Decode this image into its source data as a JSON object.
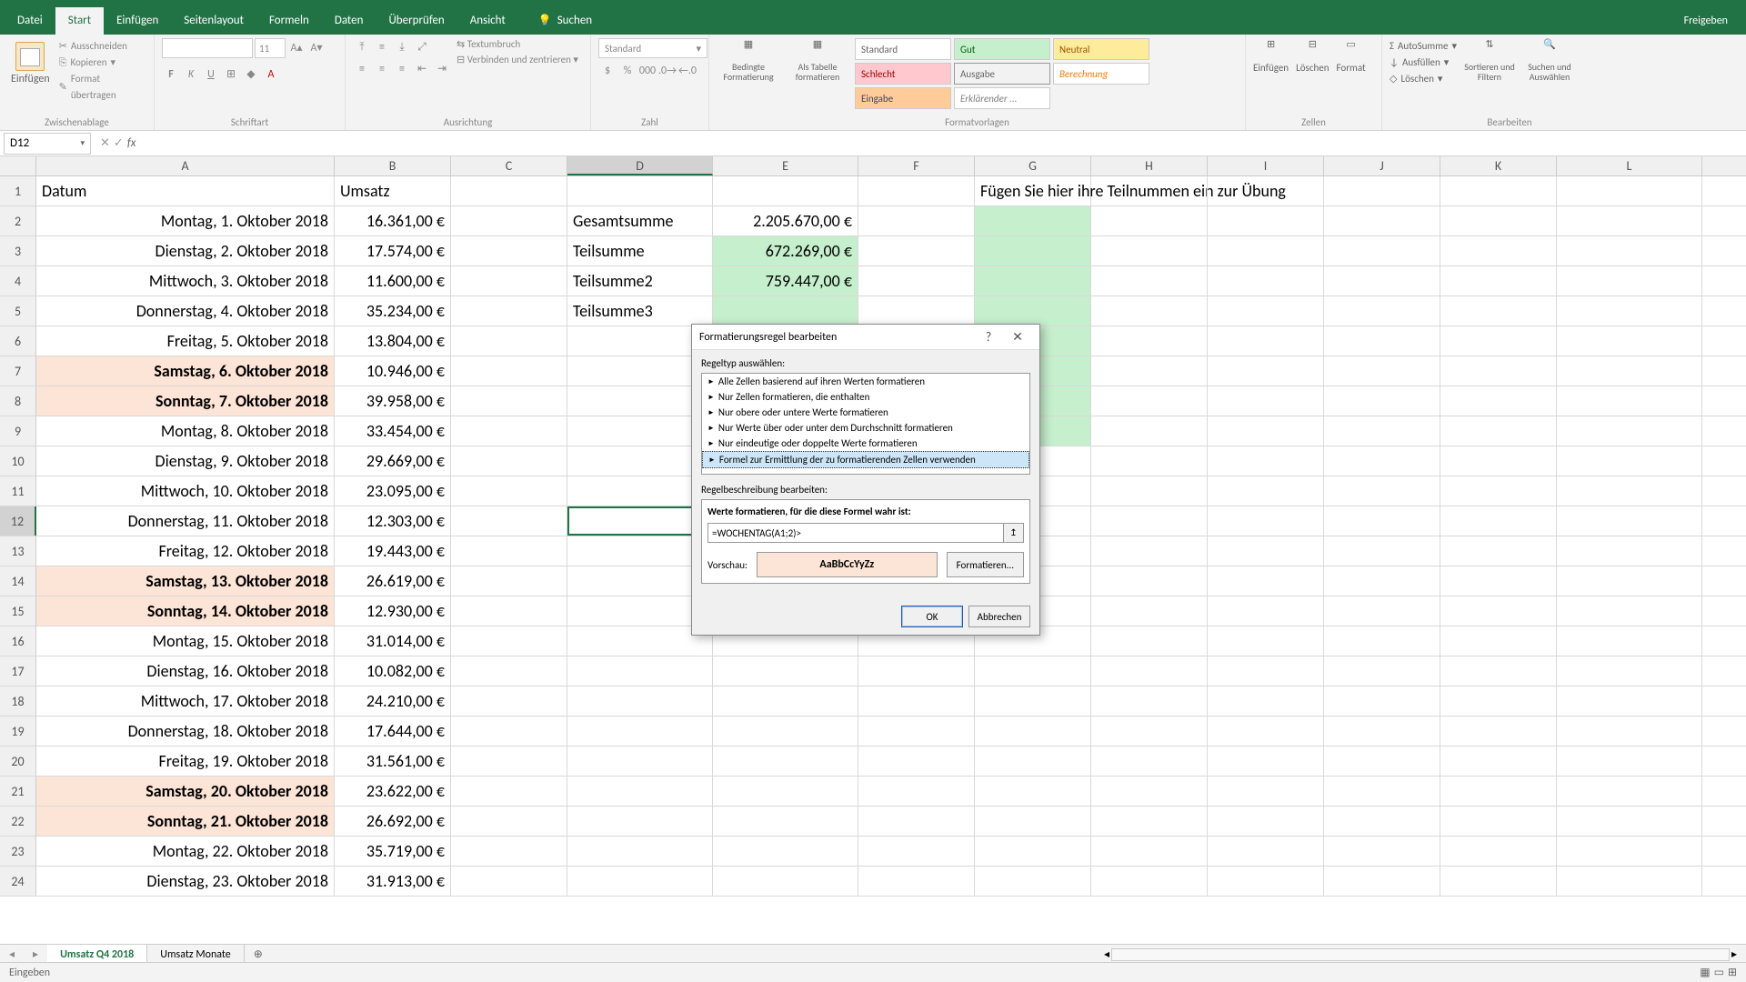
{
  "tabs": {
    "file": "Datei",
    "start": "Start",
    "insert": "Einfügen",
    "page": "Seitenlayout",
    "formulas": "Formeln",
    "data": "Daten",
    "review": "Überprüfen",
    "view": "Ansicht",
    "tell": "Suchen",
    "share": "Freigeben"
  },
  "ribbon": {
    "paste": "Einfügen",
    "cut": "Ausschneiden",
    "copy": "Kopieren",
    "format_painter": "Format übertragen",
    "clipboard": "Zwischenablage",
    "font_name": "",
    "font_size": "11",
    "font_group": "Schriftart",
    "wrap": "Textumbruch",
    "merge": "Verbinden und zentrieren",
    "alignment": "Ausrichtung",
    "num_format": "Standard",
    "number": "Zahl",
    "cond_fmt": "Bedingte Formatierung",
    "as_table": "Als Tabelle formatieren",
    "styles_group": "Formatvorlagen",
    "style_standard": "Standard",
    "style_good": "Gut",
    "style_neutral": "Neutral",
    "style_bad": "Schlecht",
    "style_output": "Ausgabe",
    "style_calc": "Berechnung",
    "style_input": "Eingabe",
    "style_explain": "Erklärender ...",
    "insert_cells": "Einfügen",
    "delete_cells": "Löschen",
    "format_cells": "Format",
    "cells_group": "Zellen",
    "autosum": "AutoSumme",
    "fill": "Ausfüllen",
    "clear": "Löschen",
    "sort_filter": "Sortieren und Filtern",
    "find": "Suchen und Auswählen",
    "editing": "Bearbeiten"
  },
  "namebox": "D12",
  "columns": [
    "A",
    "B",
    "C",
    "D",
    "E",
    "F",
    "G",
    "H",
    "I",
    "J",
    "K",
    "L"
  ],
  "headers": {
    "a1": "Datum",
    "b1": "Umsatz",
    "g1": "Fügen Sie hier ihre Teilnummen ein zur Übung"
  },
  "sums": {
    "d2": "Gesamtsumme",
    "e2": "2.205.670,00 €",
    "d3": "Teilsumme",
    "e3": "672.269,00 €",
    "d4": "Teilsumme2",
    "e4": "759.447,00 €",
    "d5": "Teilsumme3"
  },
  "data_rows": [
    {
      "r": 2,
      "date": "Montag, 1. Oktober 2018",
      "val": "16.361,00 €",
      "w": false
    },
    {
      "r": 3,
      "date": "Dienstag, 2. Oktober 2018",
      "val": "17.574,00 €",
      "w": false
    },
    {
      "r": 4,
      "date": "Mittwoch, 3. Oktober 2018",
      "val": "11.600,00 €",
      "w": false
    },
    {
      "r": 5,
      "date": "Donnerstag, 4. Oktober 2018",
      "val": "35.234,00 €",
      "w": false
    },
    {
      "r": 6,
      "date": "Freitag, 5. Oktober 2018",
      "val": "13.804,00 €",
      "w": false
    },
    {
      "r": 7,
      "date": "Samstag, 6. Oktober 2018",
      "val": "10.946,00 €",
      "w": true
    },
    {
      "r": 8,
      "date": "Sonntag, 7. Oktober 2018",
      "val": "39.958,00 €",
      "w": true
    },
    {
      "r": 9,
      "date": "Montag, 8. Oktober 2018",
      "val": "33.454,00 €",
      "w": false
    },
    {
      "r": 10,
      "date": "Dienstag, 9. Oktober 2018",
      "val": "29.669,00 €",
      "w": false
    },
    {
      "r": 11,
      "date": "Mittwoch, 10. Oktober 2018",
      "val": "23.095,00 €",
      "w": false
    },
    {
      "r": 12,
      "date": "Donnerstag, 11. Oktober 2018",
      "val": "12.303,00 €",
      "w": false
    },
    {
      "r": 13,
      "date": "Freitag, 12. Oktober 2018",
      "val": "19.443,00 €",
      "w": false
    },
    {
      "r": 14,
      "date": "Samstag, 13. Oktober 2018",
      "val": "26.619,00 €",
      "w": true
    },
    {
      "r": 15,
      "date": "Sonntag, 14. Oktober 2018",
      "val": "12.930,00 €",
      "w": true
    },
    {
      "r": 16,
      "date": "Montag, 15. Oktober 2018",
      "val": "31.014,00 €",
      "w": false
    },
    {
      "r": 17,
      "date": "Dienstag, 16. Oktober 2018",
      "val": "10.082,00 €",
      "w": false
    },
    {
      "r": 18,
      "date": "Mittwoch, 17. Oktober 2018",
      "val": "24.210,00 €",
      "w": false
    },
    {
      "r": 19,
      "date": "Donnerstag, 18. Oktober 2018",
      "val": "17.644,00 €",
      "w": false
    },
    {
      "r": 20,
      "date": "Freitag, 19. Oktober 2018",
      "val": "31.561,00 €",
      "w": false
    },
    {
      "r": 21,
      "date": "Samstag, 20. Oktober 2018",
      "val": "23.622,00 €",
      "w": true
    },
    {
      "r": 22,
      "date": "Sonntag, 21. Oktober 2018",
      "val": "26.692,00 €",
      "w": true
    },
    {
      "r": 23,
      "date": "Montag, 22. Oktober 2018",
      "val": "35.719,00 €",
      "w": false
    },
    {
      "r": 24,
      "date": "Dienstag, 23. Oktober 2018",
      "val": "31.913,00 €",
      "w": false
    }
  ],
  "sheets": {
    "s1": "Umsatz Q4 2018",
    "s2": "Umsatz Monate"
  },
  "status": "Eingeben",
  "dialog": {
    "title": "Formatierungsregel bearbeiten",
    "select_label": "Regeltyp auswählen:",
    "rules": [
      "Alle Zellen basierend auf ihren Werten formatieren",
      "Nur Zellen formatieren, die enthalten",
      "Nur obere oder untere Werte formatieren",
      "Nur Werte über oder unter dem Durchschnitt formatieren",
      "Nur eindeutige oder doppelte Werte formatieren",
      "Formel zur Ermittlung der zu formatierenden Zellen verwenden"
    ],
    "desc_label": "Regelbeschreibung bearbeiten:",
    "formula_label": "Werte formatieren, für die diese Formel wahr ist:",
    "formula_value": "=WOCHENTAG(A1;2)>",
    "preview_label": "Vorschau:",
    "preview_text": "AaBbCcYyZz",
    "format_btn": "Formatieren...",
    "ok": "OK",
    "cancel": "Abbrechen"
  }
}
